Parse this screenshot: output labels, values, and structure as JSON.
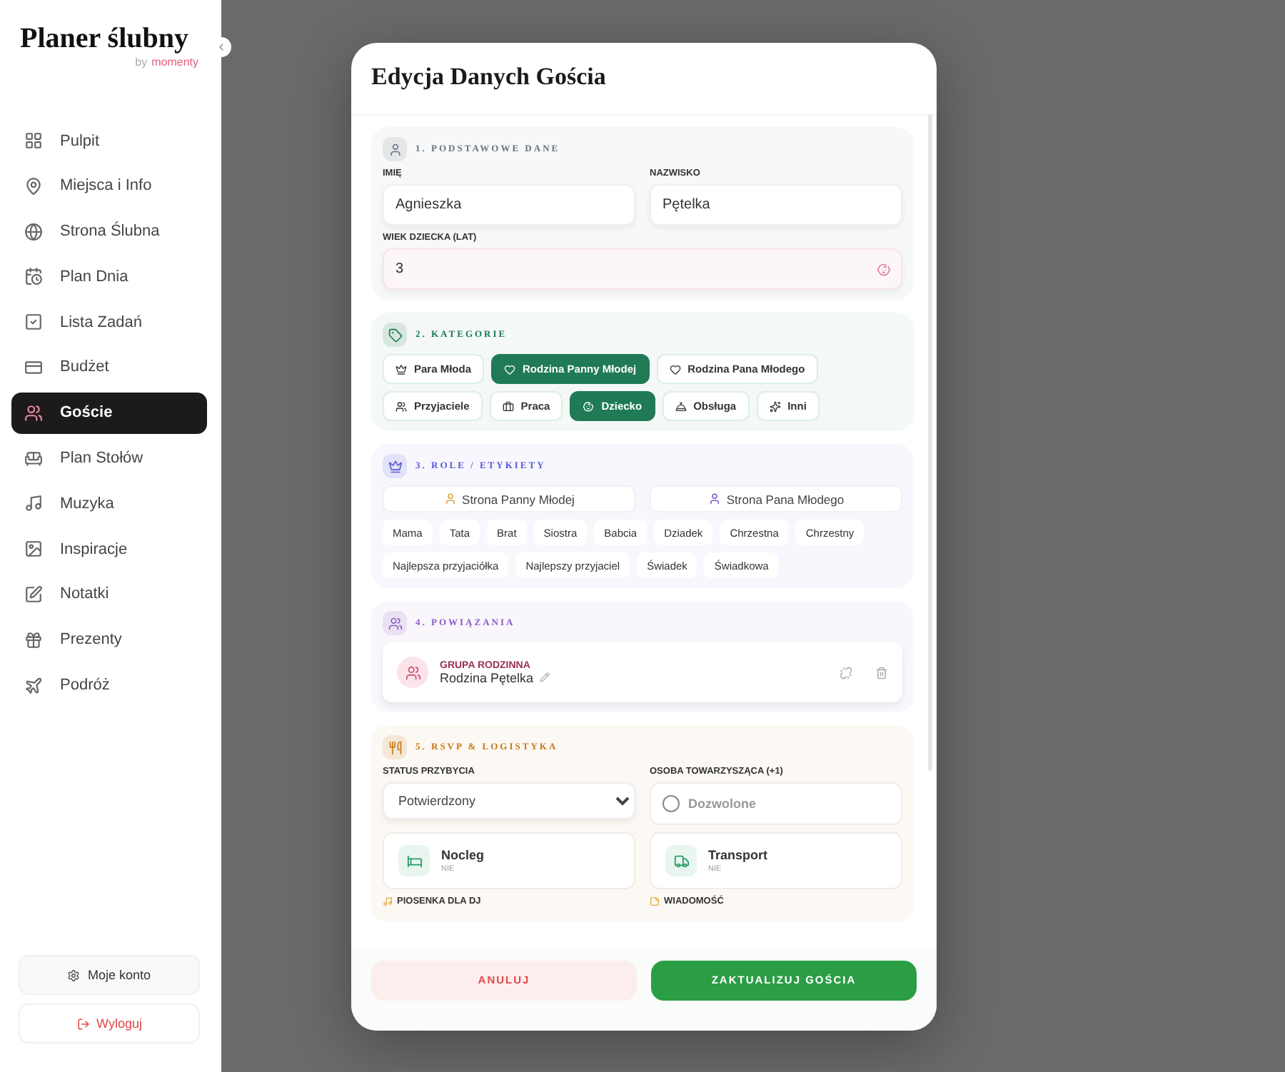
{
  "brand": {
    "title": "Planer ślubny",
    "byline": "by",
    "sub": "momenty"
  },
  "sidebar": {
    "items": [
      {
        "label": "Pulpit",
        "selected": false
      },
      {
        "label": "Miejsca i Info",
        "selected": false
      },
      {
        "label": "Strona Ślubna",
        "selected": false
      },
      {
        "label": "Plan Dnia",
        "selected": false
      },
      {
        "label": "Lista Zadań",
        "selected": false
      },
      {
        "label": "Budżet",
        "selected": false
      },
      {
        "label": "Goście",
        "selected": true
      },
      {
        "label": "Plan Stołów",
        "selected": false
      },
      {
        "label": "Muzyka",
        "selected": false
      },
      {
        "label": "Inspiracje",
        "selected": false
      },
      {
        "label": "Notatki",
        "selected": false
      },
      {
        "label": "Prezenty",
        "selected": false
      },
      {
        "label": "Podróż",
        "selected": false
      }
    ],
    "account": "Moje konto",
    "logout": "Wyloguj"
  },
  "modal": {
    "title": "Edycja Danych Gościa",
    "sections": [
      {
        "kind": "basic",
        "title": "1. PODSTAWOWE DANE",
        "fields": [
          {
            "label": "IMIĘ",
            "value": "Agnieszka"
          },
          {
            "label": "NAZWISKO",
            "value": "Pętelka"
          }
        ],
        "age": {
          "label": "WIEK DZIECKA (LAT)",
          "value": "3"
        }
      },
      {
        "kind": "categories",
        "title": "2. KATEGORIE",
        "chips": [
          {
            "label": "Para Młoda",
            "selected": false
          },
          {
            "label": "Rodzina Panny Młodej",
            "selected": true
          },
          {
            "label": "Rodzina Pana Młodego",
            "selected": false
          },
          {
            "label": "Przyjaciele",
            "selected": false
          },
          {
            "label": "Praca",
            "selected": false
          },
          {
            "label": "Dziecko",
            "selected": true
          },
          {
            "label": "Obsługa",
            "selected": false
          },
          {
            "label": "Inni",
            "selected": false
          }
        ]
      },
      {
        "kind": "roles",
        "title": "3. ROLE / ETYKIETY",
        "sides": [
          {
            "label": "Strona Panny Młodej",
            "selected": false
          },
          {
            "label": "Strona Pana Młodego",
            "selected": false
          }
        ],
        "chips": [
          {
            "label": "Mama",
            "selected": false
          },
          {
            "label": "Tata",
            "selected": false
          },
          {
            "label": "Brat",
            "selected": false
          },
          {
            "label": "Siostra",
            "selected": false
          },
          {
            "label": "Babcia",
            "selected": false
          },
          {
            "label": "Dziadek",
            "selected": false
          },
          {
            "label": "Chrzestna",
            "selected": false
          },
          {
            "label": "Chrzestny",
            "selected": false
          },
          {
            "label": "Najlepsza przyjaciółka",
            "selected": false
          },
          {
            "label": "Najlepszy przyjaciel",
            "selected": false
          },
          {
            "label": "Świadek",
            "selected": false
          },
          {
            "label": "Świadkowa",
            "selected": false
          }
        ]
      },
      {
        "kind": "links",
        "title": "4. POWIĄZANIA",
        "group": {
          "label": "GRUPA RODZINNA",
          "name": "Rodzina Pętelka"
        }
      },
      {
        "kind": "rsvp",
        "title": "5. RSVP & LOGISTYKA",
        "status": {
          "label": "STATUS PRZYBYCIA",
          "value": "Potwierdzony"
        },
        "plus_one": {
          "label": "OSOBA TOWARZYSZĄCA (+1)",
          "option": "Dozwolone",
          "checked": false
        },
        "toggles": [
          {
            "label": "Nocleg",
            "state": "NIE"
          },
          {
            "label": "Transport",
            "state": "NIE"
          }
        ],
        "extras": [
          {
            "label": "PIOSENKA DLA DJ"
          },
          {
            "label": "WIADOMOŚĆ"
          }
        ]
      }
    ],
    "cancel": "ANULUJ",
    "submit": "ZAKTUALIZUJ GOŚCIA"
  }
}
